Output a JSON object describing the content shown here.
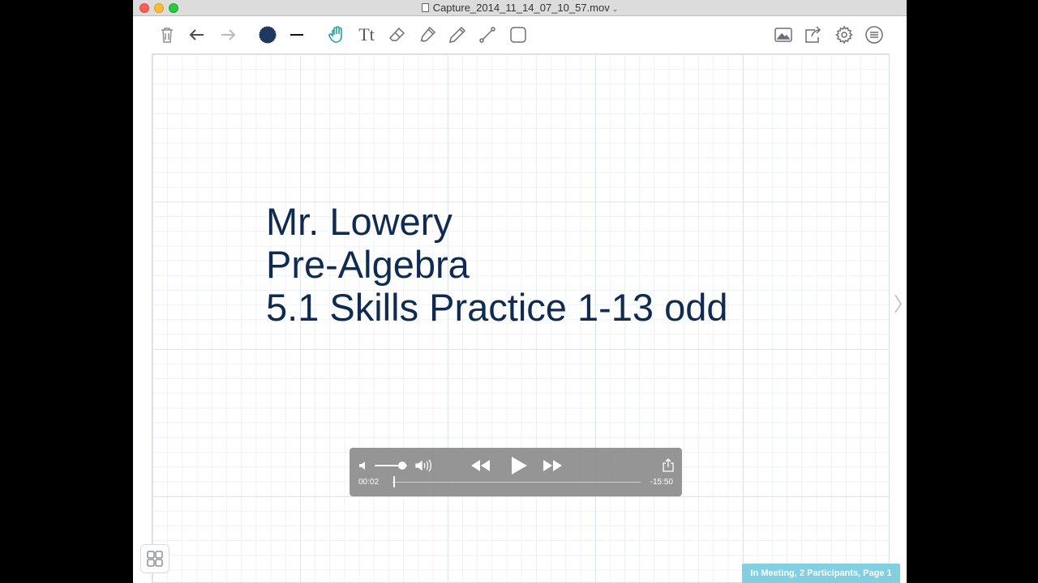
{
  "window": {
    "title": "Capture_2014_11_14_07_10_57.mov"
  },
  "toolbar": {
    "left_tools": [
      "trash-icon",
      "undo-icon",
      "redo-icon",
      "pen-color-icon",
      "stroke-width-icon",
      "hand-icon",
      "text-tool-icon",
      "eraser-icon",
      "highlighter-icon",
      "pencil-icon",
      "line-icon",
      "shape-icon"
    ],
    "text_tool_label": "Tt",
    "right_tools": [
      "insert-image-icon",
      "share-icon",
      "settings-icon",
      "menu-icon"
    ],
    "active_tool": "hand-icon",
    "active_color": "#23a09e",
    "pen_color": "#1f3a5f"
  },
  "canvas": {
    "lines": [
      "Mr. Lowery",
      "Pre-Algebra",
      "5.1 Skills Practice 1-13 odd"
    ],
    "text_color": "#0f2b52"
  },
  "player": {
    "current_time": "00:02",
    "remaining_time": "-15:50",
    "volume": 0.85,
    "progress": 0.002
  },
  "status": {
    "text": "In Meeting, 2 Participants, Page 1",
    "color": "#82cfe2"
  }
}
